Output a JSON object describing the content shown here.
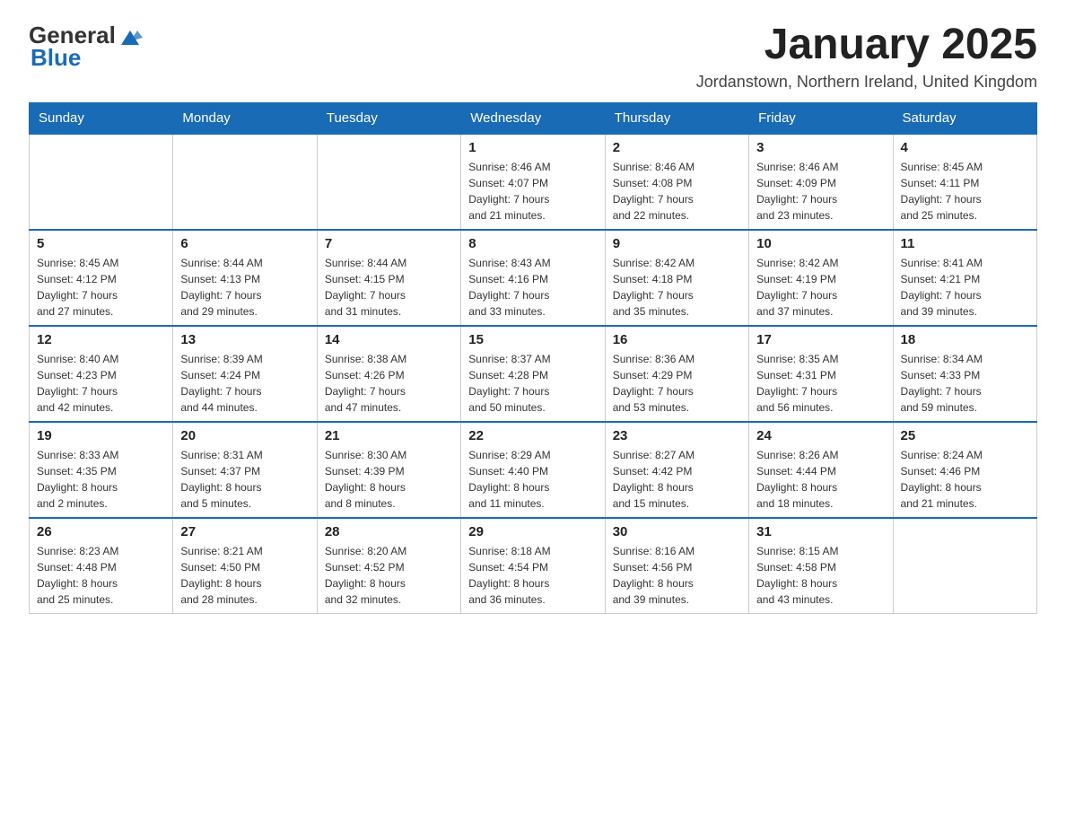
{
  "header": {
    "logo_general": "General",
    "logo_blue": "Blue",
    "title": "January 2025",
    "subtitle": "Jordanstown, Northern Ireland, United Kingdom"
  },
  "days_of_week": [
    "Sunday",
    "Monday",
    "Tuesday",
    "Wednesday",
    "Thursday",
    "Friday",
    "Saturday"
  ],
  "weeks": [
    [
      {
        "day": "",
        "info": ""
      },
      {
        "day": "",
        "info": ""
      },
      {
        "day": "",
        "info": ""
      },
      {
        "day": "1",
        "info": "Sunrise: 8:46 AM\nSunset: 4:07 PM\nDaylight: 7 hours\nand 21 minutes."
      },
      {
        "day": "2",
        "info": "Sunrise: 8:46 AM\nSunset: 4:08 PM\nDaylight: 7 hours\nand 22 minutes."
      },
      {
        "day": "3",
        "info": "Sunrise: 8:46 AM\nSunset: 4:09 PM\nDaylight: 7 hours\nand 23 minutes."
      },
      {
        "day": "4",
        "info": "Sunrise: 8:45 AM\nSunset: 4:11 PM\nDaylight: 7 hours\nand 25 minutes."
      }
    ],
    [
      {
        "day": "5",
        "info": "Sunrise: 8:45 AM\nSunset: 4:12 PM\nDaylight: 7 hours\nand 27 minutes."
      },
      {
        "day": "6",
        "info": "Sunrise: 8:44 AM\nSunset: 4:13 PM\nDaylight: 7 hours\nand 29 minutes."
      },
      {
        "day": "7",
        "info": "Sunrise: 8:44 AM\nSunset: 4:15 PM\nDaylight: 7 hours\nand 31 minutes."
      },
      {
        "day": "8",
        "info": "Sunrise: 8:43 AM\nSunset: 4:16 PM\nDaylight: 7 hours\nand 33 minutes."
      },
      {
        "day": "9",
        "info": "Sunrise: 8:42 AM\nSunset: 4:18 PM\nDaylight: 7 hours\nand 35 minutes."
      },
      {
        "day": "10",
        "info": "Sunrise: 8:42 AM\nSunset: 4:19 PM\nDaylight: 7 hours\nand 37 minutes."
      },
      {
        "day": "11",
        "info": "Sunrise: 8:41 AM\nSunset: 4:21 PM\nDaylight: 7 hours\nand 39 minutes."
      }
    ],
    [
      {
        "day": "12",
        "info": "Sunrise: 8:40 AM\nSunset: 4:23 PM\nDaylight: 7 hours\nand 42 minutes."
      },
      {
        "day": "13",
        "info": "Sunrise: 8:39 AM\nSunset: 4:24 PM\nDaylight: 7 hours\nand 44 minutes."
      },
      {
        "day": "14",
        "info": "Sunrise: 8:38 AM\nSunset: 4:26 PM\nDaylight: 7 hours\nand 47 minutes."
      },
      {
        "day": "15",
        "info": "Sunrise: 8:37 AM\nSunset: 4:28 PM\nDaylight: 7 hours\nand 50 minutes."
      },
      {
        "day": "16",
        "info": "Sunrise: 8:36 AM\nSunset: 4:29 PM\nDaylight: 7 hours\nand 53 minutes."
      },
      {
        "day": "17",
        "info": "Sunrise: 8:35 AM\nSunset: 4:31 PM\nDaylight: 7 hours\nand 56 minutes."
      },
      {
        "day": "18",
        "info": "Sunrise: 8:34 AM\nSunset: 4:33 PM\nDaylight: 7 hours\nand 59 minutes."
      }
    ],
    [
      {
        "day": "19",
        "info": "Sunrise: 8:33 AM\nSunset: 4:35 PM\nDaylight: 8 hours\nand 2 minutes."
      },
      {
        "day": "20",
        "info": "Sunrise: 8:31 AM\nSunset: 4:37 PM\nDaylight: 8 hours\nand 5 minutes."
      },
      {
        "day": "21",
        "info": "Sunrise: 8:30 AM\nSunset: 4:39 PM\nDaylight: 8 hours\nand 8 minutes."
      },
      {
        "day": "22",
        "info": "Sunrise: 8:29 AM\nSunset: 4:40 PM\nDaylight: 8 hours\nand 11 minutes."
      },
      {
        "day": "23",
        "info": "Sunrise: 8:27 AM\nSunset: 4:42 PM\nDaylight: 8 hours\nand 15 minutes."
      },
      {
        "day": "24",
        "info": "Sunrise: 8:26 AM\nSunset: 4:44 PM\nDaylight: 8 hours\nand 18 minutes."
      },
      {
        "day": "25",
        "info": "Sunrise: 8:24 AM\nSunset: 4:46 PM\nDaylight: 8 hours\nand 21 minutes."
      }
    ],
    [
      {
        "day": "26",
        "info": "Sunrise: 8:23 AM\nSunset: 4:48 PM\nDaylight: 8 hours\nand 25 minutes."
      },
      {
        "day": "27",
        "info": "Sunrise: 8:21 AM\nSunset: 4:50 PM\nDaylight: 8 hours\nand 28 minutes."
      },
      {
        "day": "28",
        "info": "Sunrise: 8:20 AM\nSunset: 4:52 PM\nDaylight: 8 hours\nand 32 minutes."
      },
      {
        "day": "29",
        "info": "Sunrise: 8:18 AM\nSunset: 4:54 PM\nDaylight: 8 hours\nand 36 minutes."
      },
      {
        "day": "30",
        "info": "Sunrise: 8:16 AM\nSunset: 4:56 PM\nDaylight: 8 hours\nand 39 minutes."
      },
      {
        "day": "31",
        "info": "Sunrise: 8:15 AM\nSunset: 4:58 PM\nDaylight: 8 hours\nand 43 minutes."
      },
      {
        "day": "",
        "info": ""
      }
    ]
  ]
}
